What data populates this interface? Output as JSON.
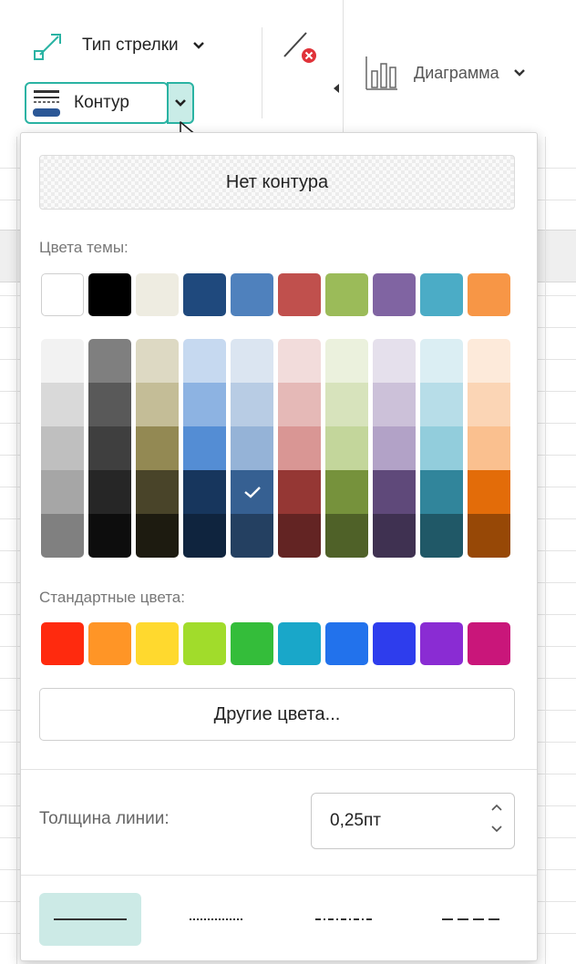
{
  "toolbar": {
    "arrow_type_label": "Тип стрелки",
    "contour_label": "Контур",
    "diagram_label": "Диаграмма"
  },
  "panel": {
    "no_outline_label": "Нет контура",
    "theme_colors_label": "Цвета темы:",
    "theme_colors": [
      "#ffffff",
      "#000000",
      "#eeece1",
      "#1f497d",
      "#4f81bd",
      "#c0504d",
      "#9bbb59",
      "#8064a2",
      "#4bacc6",
      "#f79646"
    ],
    "theme_shades": [
      [
        "#f2f2f2",
        "#d9d9d9",
        "#bfbfbf",
        "#a6a6a6",
        "#808080"
      ],
      [
        "#7f7f7f",
        "#595959",
        "#3f3f3f",
        "#262626",
        "#0d0d0d"
      ],
      [
        "#ddd9c3",
        "#c4bd97",
        "#938953",
        "#494429",
        "#1d1b10"
      ],
      [
        "#c6d9f0",
        "#8db3e2",
        "#548dd4",
        "#17365d",
        "#0f243e"
      ],
      [
        "#dbe5f1",
        "#b8cce4",
        "#95b3d7",
        "#366092",
        "#244061"
      ],
      [
        "#f2dcdb",
        "#e5b9b7",
        "#d99694",
        "#953734",
        "#632423"
      ],
      [
        "#ebf1dd",
        "#d7e3bc",
        "#c3d69b",
        "#76923c",
        "#4f6128"
      ],
      [
        "#e5e0ec",
        "#ccc1d9",
        "#b2a2c7",
        "#5f497a",
        "#3f3151"
      ],
      [
        "#dbeef3",
        "#b7dde8",
        "#92cddc",
        "#31859b",
        "#205867"
      ],
      [
        "#fdeada",
        "#fbd5b5",
        "#fac08f",
        "#e36c09",
        "#974806"
      ]
    ],
    "selected_shade": {
      "col": 4,
      "row": 3
    },
    "standard_colors_label": "Стандартные цвета:",
    "standard_colors": [
      "#ff2a0e",
      "#ff9526",
      "#ffd92e",
      "#a1dc2b",
      "#34bd3a",
      "#19a7c9",
      "#2272ec",
      "#2e3ded",
      "#8a2cd3",
      "#c9167a"
    ],
    "other_colors_label": "Другие цвета...",
    "line_thickness_label": "Толщина линии:",
    "line_thickness_value": "0,25пт",
    "dash_styles": [
      "solid",
      "dotted",
      "dash-dot",
      "dashed"
    ],
    "selected_dash": 0
  },
  "colors": {
    "accent": "#2ab3a3",
    "accent_light": "#cceae6"
  }
}
